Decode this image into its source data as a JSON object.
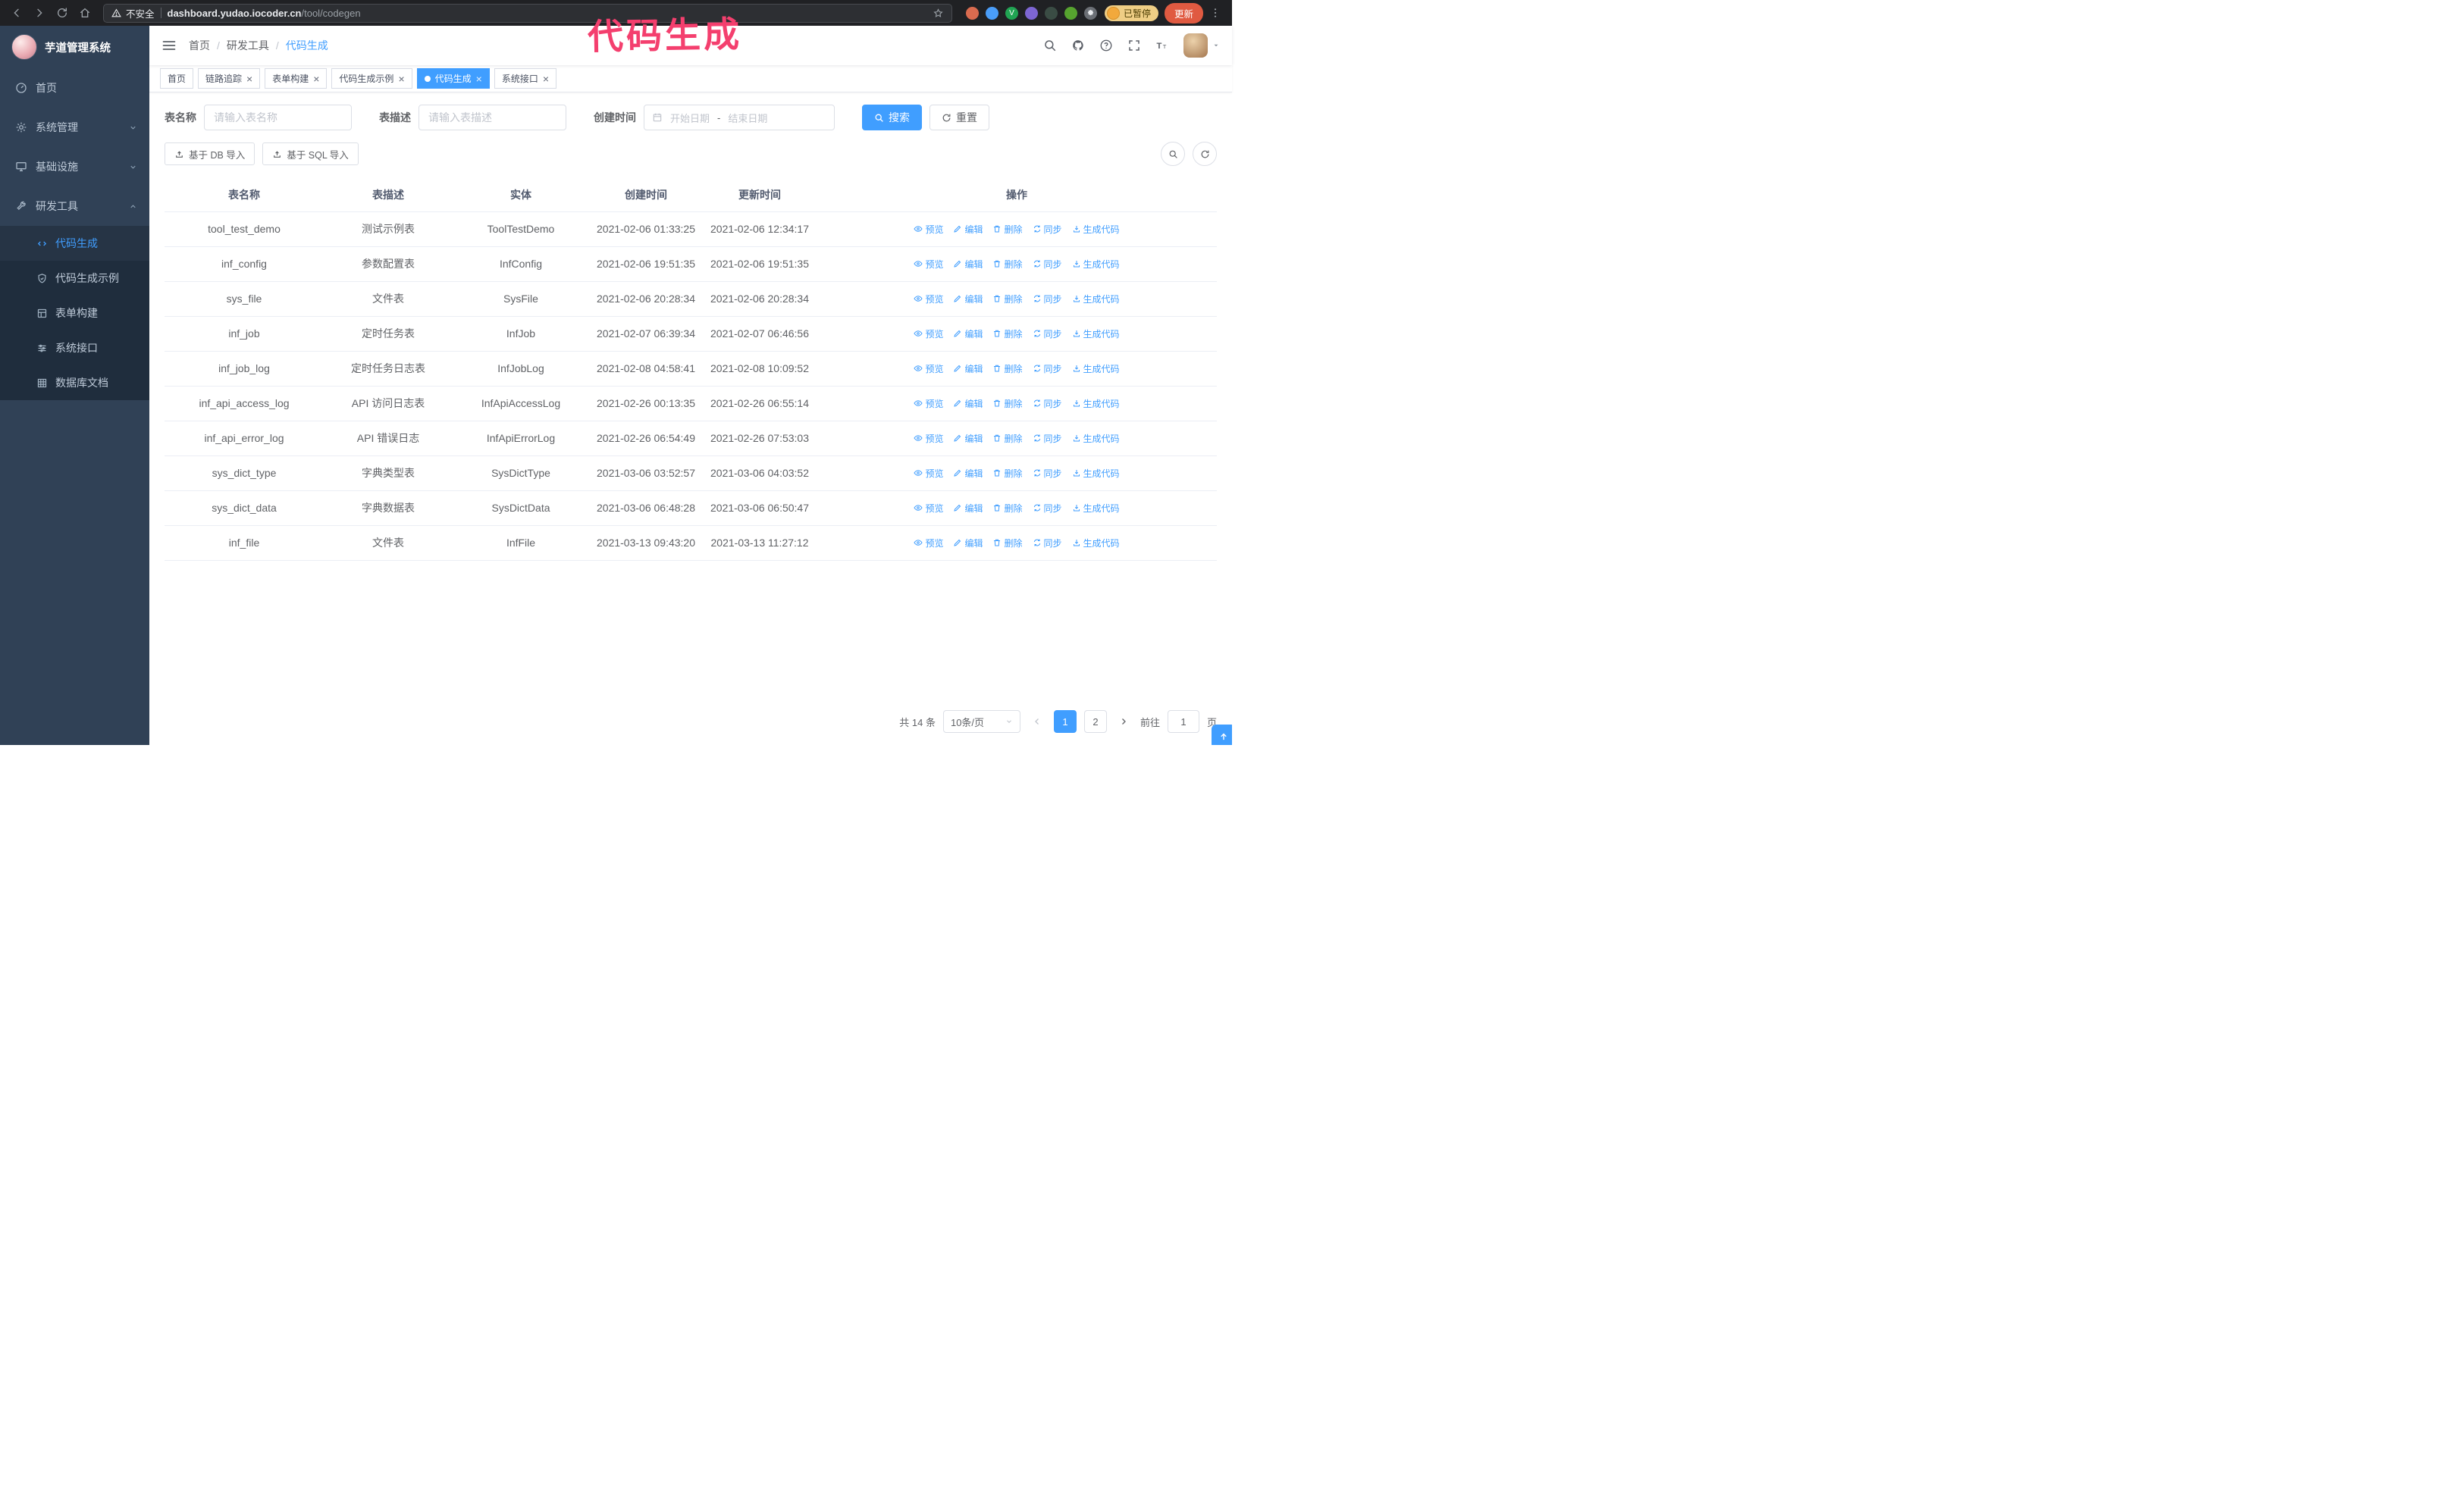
{
  "colors": {
    "accent": "#409eff",
    "sidebar_bg": "#304156",
    "submenu_bg": "#1f2d3d",
    "annotation": "#f43f6e"
  },
  "icons": {
    "close": "×"
  },
  "browser": {
    "security_label": "不安全",
    "url_domain": "dashboard.yudao.iocoder.cn",
    "url_path": "/tool/codegen",
    "paused_badge": "已暂停",
    "update_button": "更新"
  },
  "annotation": {
    "text": "代码生成"
  },
  "sidebar": {
    "title": "芋道管理系统",
    "items": [
      {
        "label": "首页"
      },
      {
        "label": "系统管理"
      },
      {
        "label": "基础设施"
      },
      {
        "label": "研发工具"
      }
    ],
    "subitems": [
      {
        "label": "代码生成",
        "active": true
      },
      {
        "label": "代码生成示例"
      },
      {
        "label": "表单构建"
      },
      {
        "label": "系统接口"
      },
      {
        "label": "数据库文档"
      }
    ]
  },
  "header": {
    "breadcrumb": [
      "首页",
      "研发工具",
      "代码生成"
    ]
  },
  "tags": [
    {
      "label": "首页",
      "closable": false,
      "active": false
    },
    {
      "label": "链路追踪",
      "closable": true,
      "active": false
    },
    {
      "label": "表单构建",
      "closable": true,
      "active": false
    },
    {
      "label": "代码生成示例",
      "closable": true,
      "active": false
    },
    {
      "label": "代码生成",
      "closable": true,
      "active": true
    },
    {
      "label": "系统接口",
      "closable": true,
      "active": false
    }
  ],
  "filters": {
    "table_name_label": "表名称",
    "table_name_placeholder": "请输入表名称",
    "table_desc_label": "表描述",
    "table_desc_placeholder": "请输入表描述",
    "create_time_label": "创建时间",
    "date_start_placeholder": "开始日期",
    "date_separator": "-",
    "date_end_placeholder": "结束日期",
    "search_button": "搜索",
    "reset_button": "重置"
  },
  "toolbar": {
    "import_db_button": "基于 DB 导入",
    "import_sql_button": "基于 SQL 导入"
  },
  "table": {
    "headers": [
      "表名称",
      "表描述",
      "实体",
      "创建时间",
      "更新时间",
      "操作"
    ],
    "actions": [
      "预览",
      "编辑",
      "删除",
      "同步",
      "生成代码"
    ],
    "rows": [
      {
        "name": "tool_test_demo",
        "desc": "测试示例表",
        "entity": "ToolTestDemo",
        "created": "2021-02-06 01:33:25",
        "updated": "2021-02-06 12:34:17"
      },
      {
        "name": "inf_config",
        "desc": "参数配置表",
        "entity": "InfConfig",
        "created": "2021-02-06 19:51:35",
        "updated": "2021-02-06 19:51:35"
      },
      {
        "name": "sys_file",
        "desc": "文件表",
        "entity": "SysFile",
        "created": "2021-02-06 20:28:34",
        "updated": "2021-02-06 20:28:34"
      },
      {
        "name": "inf_job",
        "desc": "定时任务表",
        "entity": "InfJob",
        "created": "2021-02-07 06:39:34",
        "updated": "2021-02-07 06:46:56"
      },
      {
        "name": "inf_job_log",
        "desc": "定时任务日志表",
        "entity": "InfJobLog",
        "created": "2021-02-08 04:58:41",
        "updated": "2021-02-08 10:09:52"
      },
      {
        "name": "inf_api_access_log",
        "desc": "API 访问日志表",
        "entity": "InfApiAccessLog",
        "created": "2021-02-26 00:13:35",
        "updated": "2021-02-26 06:55:14"
      },
      {
        "name": "inf_api_error_log",
        "desc": "API 错误日志",
        "entity": "InfApiErrorLog",
        "created": "2021-02-26 06:54:49",
        "updated": "2021-02-26 07:53:03"
      },
      {
        "name": "sys_dict_type",
        "desc": "字典类型表",
        "entity": "SysDictType",
        "created": "2021-03-06 03:52:57",
        "updated": "2021-03-06 04:03:52"
      },
      {
        "name": "sys_dict_data",
        "desc": "字典数据表",
        "entity": "SysDictData",
        "created": "2021-03-06 06:48:28",
        "updated": "2021-03-06 06:50:47"
      },
      {
        "name": "inf_file",
        "desc": "文件表",
        "entity": "InfFile",
        "created": "2021-03-13 09:43:20",
        "updated": "2021-03-13 11:27:12"
      }
    ]
  },
  "pagination": {
    "total": "共 14 条",
    "page_size": "10条/页",
    "page_1": "1",
    "page_2": "2",
    "goto_label": "前往",
    "goto_value": "1",
    "goto_suffix": "页"
  }
}
